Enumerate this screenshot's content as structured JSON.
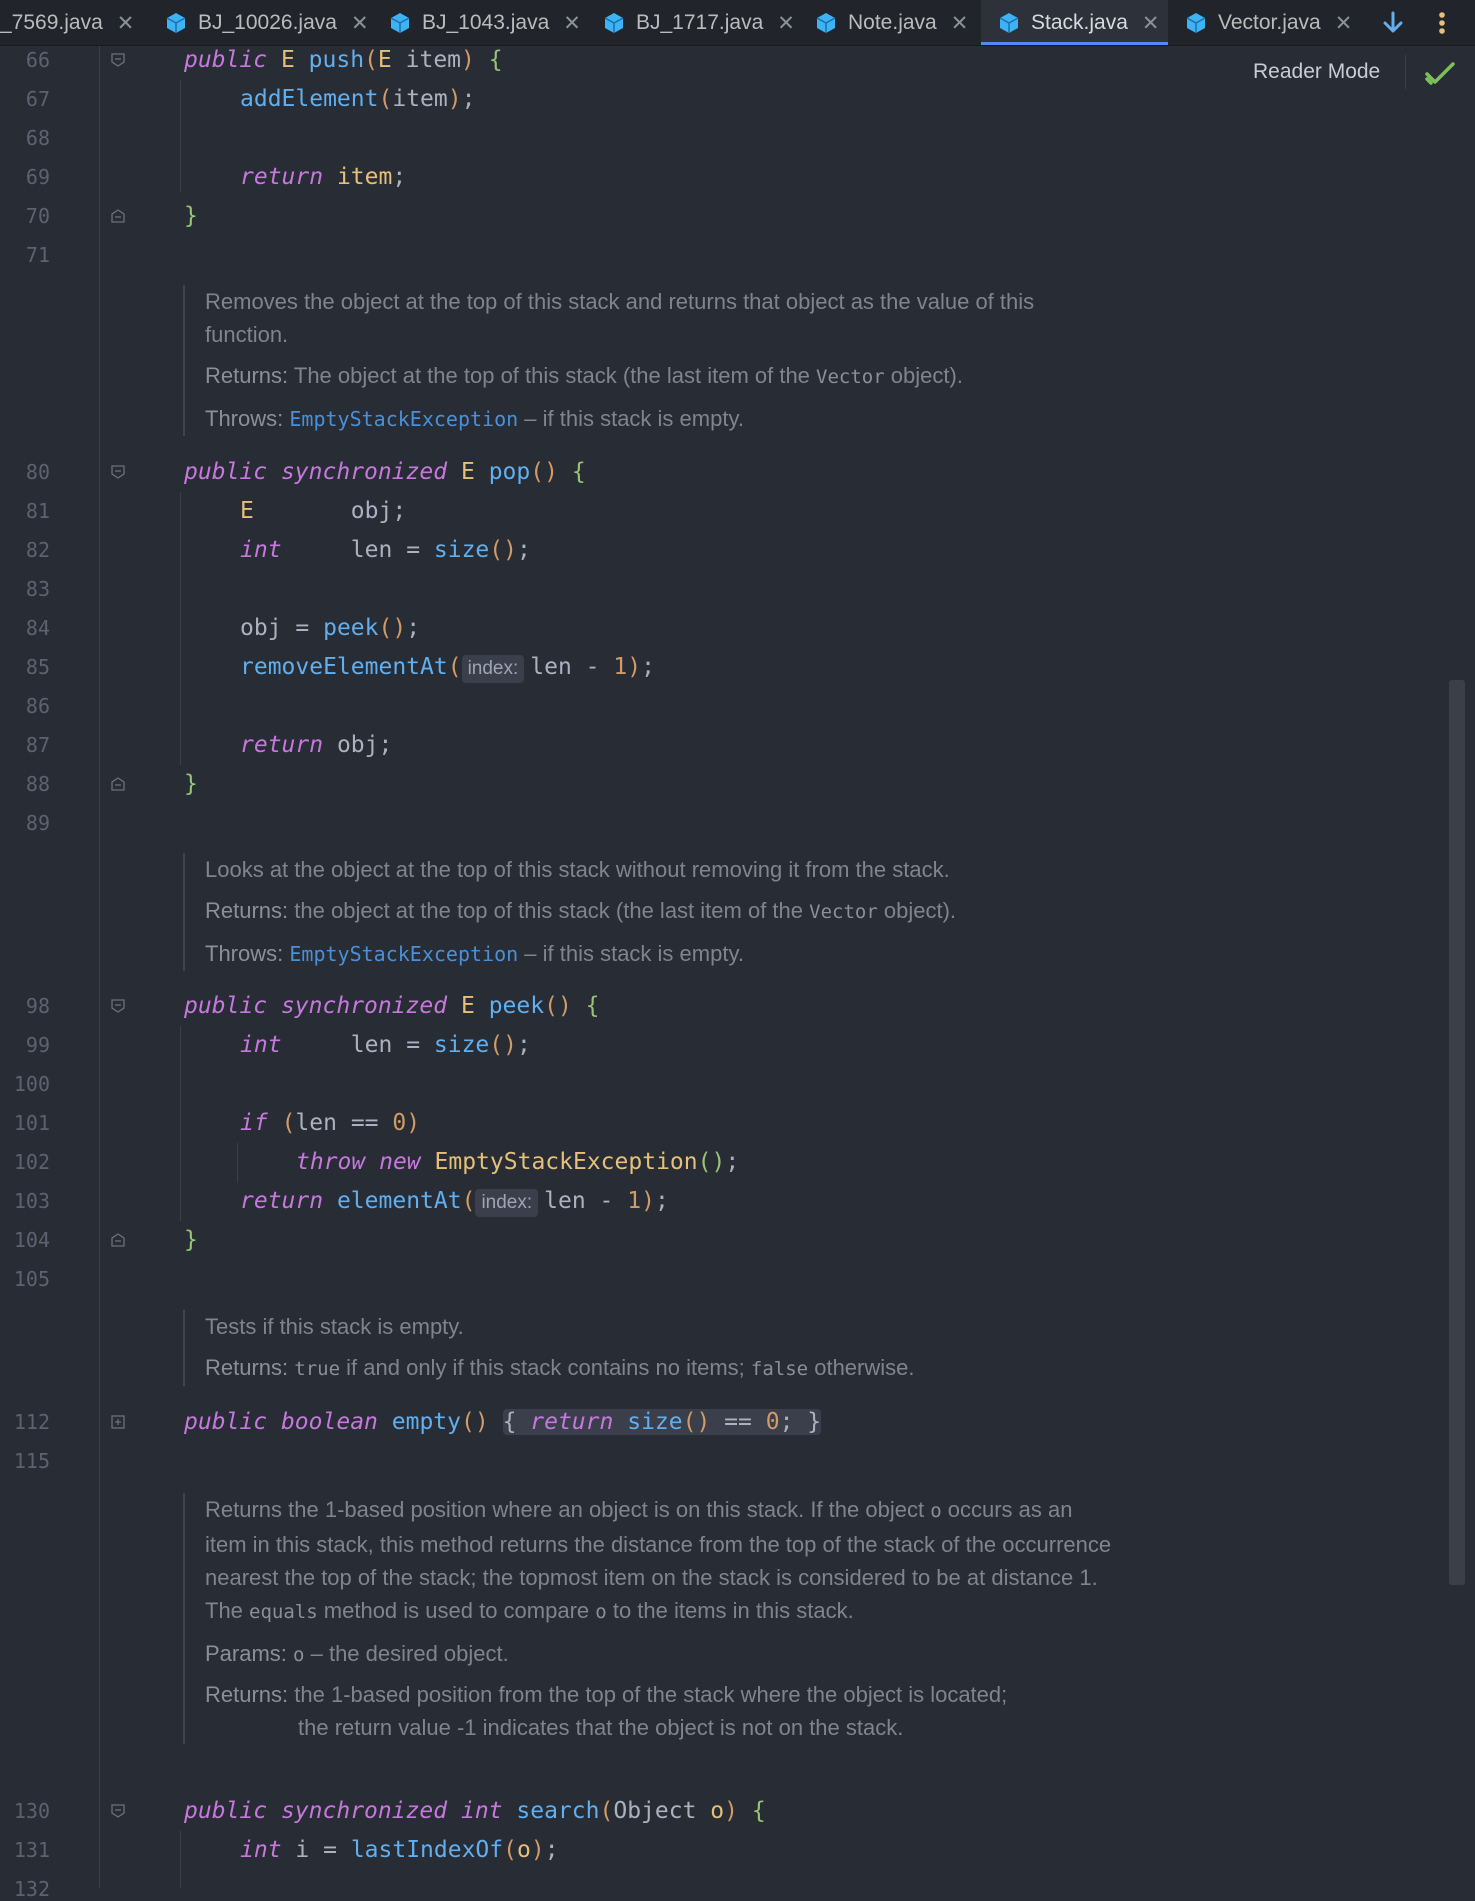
{
  "tabs": [
    {
      "label": "_7569.java",
      "active": false
    },
    {
      "label": "BJ_10026.java",
      "active": false
    },
    {
      "label": "BJ_1043.java",
      "active": false
    },
    {
      "label": "BJ_1717.java",
      "active": false
    },
    {
      "label": "Note.java",
      "active": false
    },
    {
      "label": "Stack.java",
      "active": true
    },
    {
      "label": "Vector.java",
      "active": false
    }
  ],
  "tab_close_glyph": "✕",
  "reader_mode": "Reader Mode",
  "line_numbers": [
    "66",
    "67",
    "68",
    "69",
    "70",
    "71",
    "80",
    "81",
    "82",
    "83",
    "84",
    "85",
    "86",
    "87",
    "88",
    "89",
    "98",
    "99",
    "100",
    "101",
    "102",
    "103",
    "104",
    "105",
    "112",
    "115",
    "130",
    "131",
    "132"
  ],
  "code": {
    "push": {
      "kw": "public",
      "ret": "E",
      "name": "push",
      "ptype": "E",
      "pname": "item"
    },
    "add_element_call": "addElement",
    "item": "item",
    "return_kw": "return",
    "pop": {
      "kw": "public",
      "sync": "synchronized",
      "ret": "E",
      "name": "pop"
    },
    "pop_obj_type": "E",
    "obj": "obj",
    "int_kw": "int",
    "len": "len",
    "size_call": "size",
    "peek_call": "peek",
    "remove_element_at": "removeElementAt",
    "hint_index": "index:",
    "one": "1",
    "zero": "0",
    "peek": {
      "kw": "public",
      "sync": "synchronized",
      "ret": "E",
      "name": "peek"
    },
    "if_kw": "if",
    "throw_kw": "throw",
    "new_kw": "new",
    "empty_stack_exception": "EmptyStackException",
    "element_at": "elementAt",
    "empty": {
      "kw": "public",
      "ret": "boolean",
      "name": "empty"
    },
    "search": {
      "kw": "public",
      "sync": "synchronized",
      "ret": "int",
      "name": "search",
      "ptype": "Object",
      "pname": "o"
    },
    "i": "i",
    "last_index_of": "lastIndexOf",
    "o": "o"
  },
  "docs": {
    "pop": {
      "summary": "Removes the object at the top of this stack and returns that object as the value of this function.",
      "returns_tag": "Returns:",
      "returns_pre": "The object at the top of this stack (the last item of the ",
      "returns_code": "Vector",
      "returns_post": " object).",
      "throws_tag": "Throws:",
      "throws_link": "EmptyStackException",
      "throws_text": " – if this stack is empty."
    },
    "peek": {
      "summary": "Looks at the object at the top of this stack without removing it from the stack.",
      "returns_tag": "Returns:",
      "returns_pre": "the object at the top of this stack (the last item of the ",
      "returns_code": "Vector",
      "returns_post": " object).",
      "throws_tag": "Throws:",
      "throws_link": "EmptyStackException",
      "throws_text": " – if this stack is empty."
    },
    "empty": {
      "summary": "Tests if this stack is empty.",
      "returns_tag": "Returns:",
      "returns_code1": "true",
      "returns_mid": " if and only if this stack contains no items; ",
      "returns_code2": "false",
      "returns_post": " otherwise."
    },
    "search": {
      "s1": "Returns the 1-based position where an object is on this stack. If the object ",
      "s1_code": "o",
      "s2": " occurs as an item in this stack, this method returns the distance from the top of the stack of the occurrence nearest the top of the stack; the topmost item on the stack is considered to be at distance 1. The ",
      "s2_code": "equals",
      "s3": " method is used to compare ",
      "s3_code": "o",
      "s4": " to the items in this stack.",
      "params_tag": "Params:",
      "params_code": "o",
      "params_text": " – the desired object.",
      "returns_tag": "Returns:",
      "returns_l1": "the 1-based position from the top of the stack where the object is located;",
      "returns_l2": "the return value -1 indicates that the object is not on the stack."
    }
  },
  "colors": {
    "editor_bg": "#282c34",
    "keyword": "#c678dd",
    "type": "#e5c07b",
    "function": "#61afef",
    "number": "#d19a66",
    "paren": "#d19a66",
    "brace": "#98c379",
    "doc_text": "#7f848e",
    "doc_link": "#4a90d9",
    "tab_accent": "#568af2",
    "check": "#7fbf5a"
  }
}
